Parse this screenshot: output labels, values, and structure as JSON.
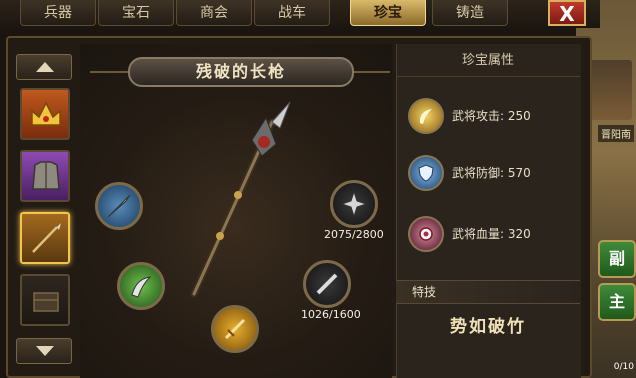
{
  "tabs": [
    {
      "label": "兵器",
      "active": false
    },
    {
      "label": "宝石",
      "active": false
    },
    {
      "label": "商会",
      "active": false
    },
    {
      "label": "战车",
      "active": false
    },
    {
      "label": "珍宝",
      "active": true
    },
    {
      "label": "铸造",
      "active": false
    }
  ],
  "close_label": "X",
  "item": {
    "name": "残破的长枪"
  },
  "gems": [
    {
      "icon": "blue-spear-gem-icon",
      "progress": ""
    },
    {
      "icon": "green-blade-gem-icon",
      "progress": ""
    },
    {
      "icon": "gold-dagger-gem-icon",
      "progress": ""
    },
    {
      "icon": "silver-shuriken-gem-icon",
      "progress": "2075/2800"
    },
    {
      "icon": "silver-knife-gem-icon",
      "progress": "1026/1600"
    }
  ],
  "info": {
    "title": "珍宝属性",
    "attributes": [
      {
        "label": "武将攻击",
        "value": "250",
        "text": "武将攻击: 250",
        "icon": "attack-icon"
      },
      {
        "label": "武将防御",
        "value": "570",
        "text": "武将防御: 570",
        "icon": "defense-icon"
      },
      {
        "label": "武将血量",
        "value": "320",
        "text": "武将血量: 320",
        "icon": "health-icon"
      }
    ],
    "skill_header": "特技",
    "skill_name": "势如破竹"
  },
  "side": {
    "city_label": "晋阳南",
    "btn1": "副",
    "btn2": "主",
    "count": "0/10"
  },
  "colors": {
    "accent_gold": "#d9ba6b",
    "close_red": "#c0392b",
    "panel_bg": "#211b14"
  }
}
